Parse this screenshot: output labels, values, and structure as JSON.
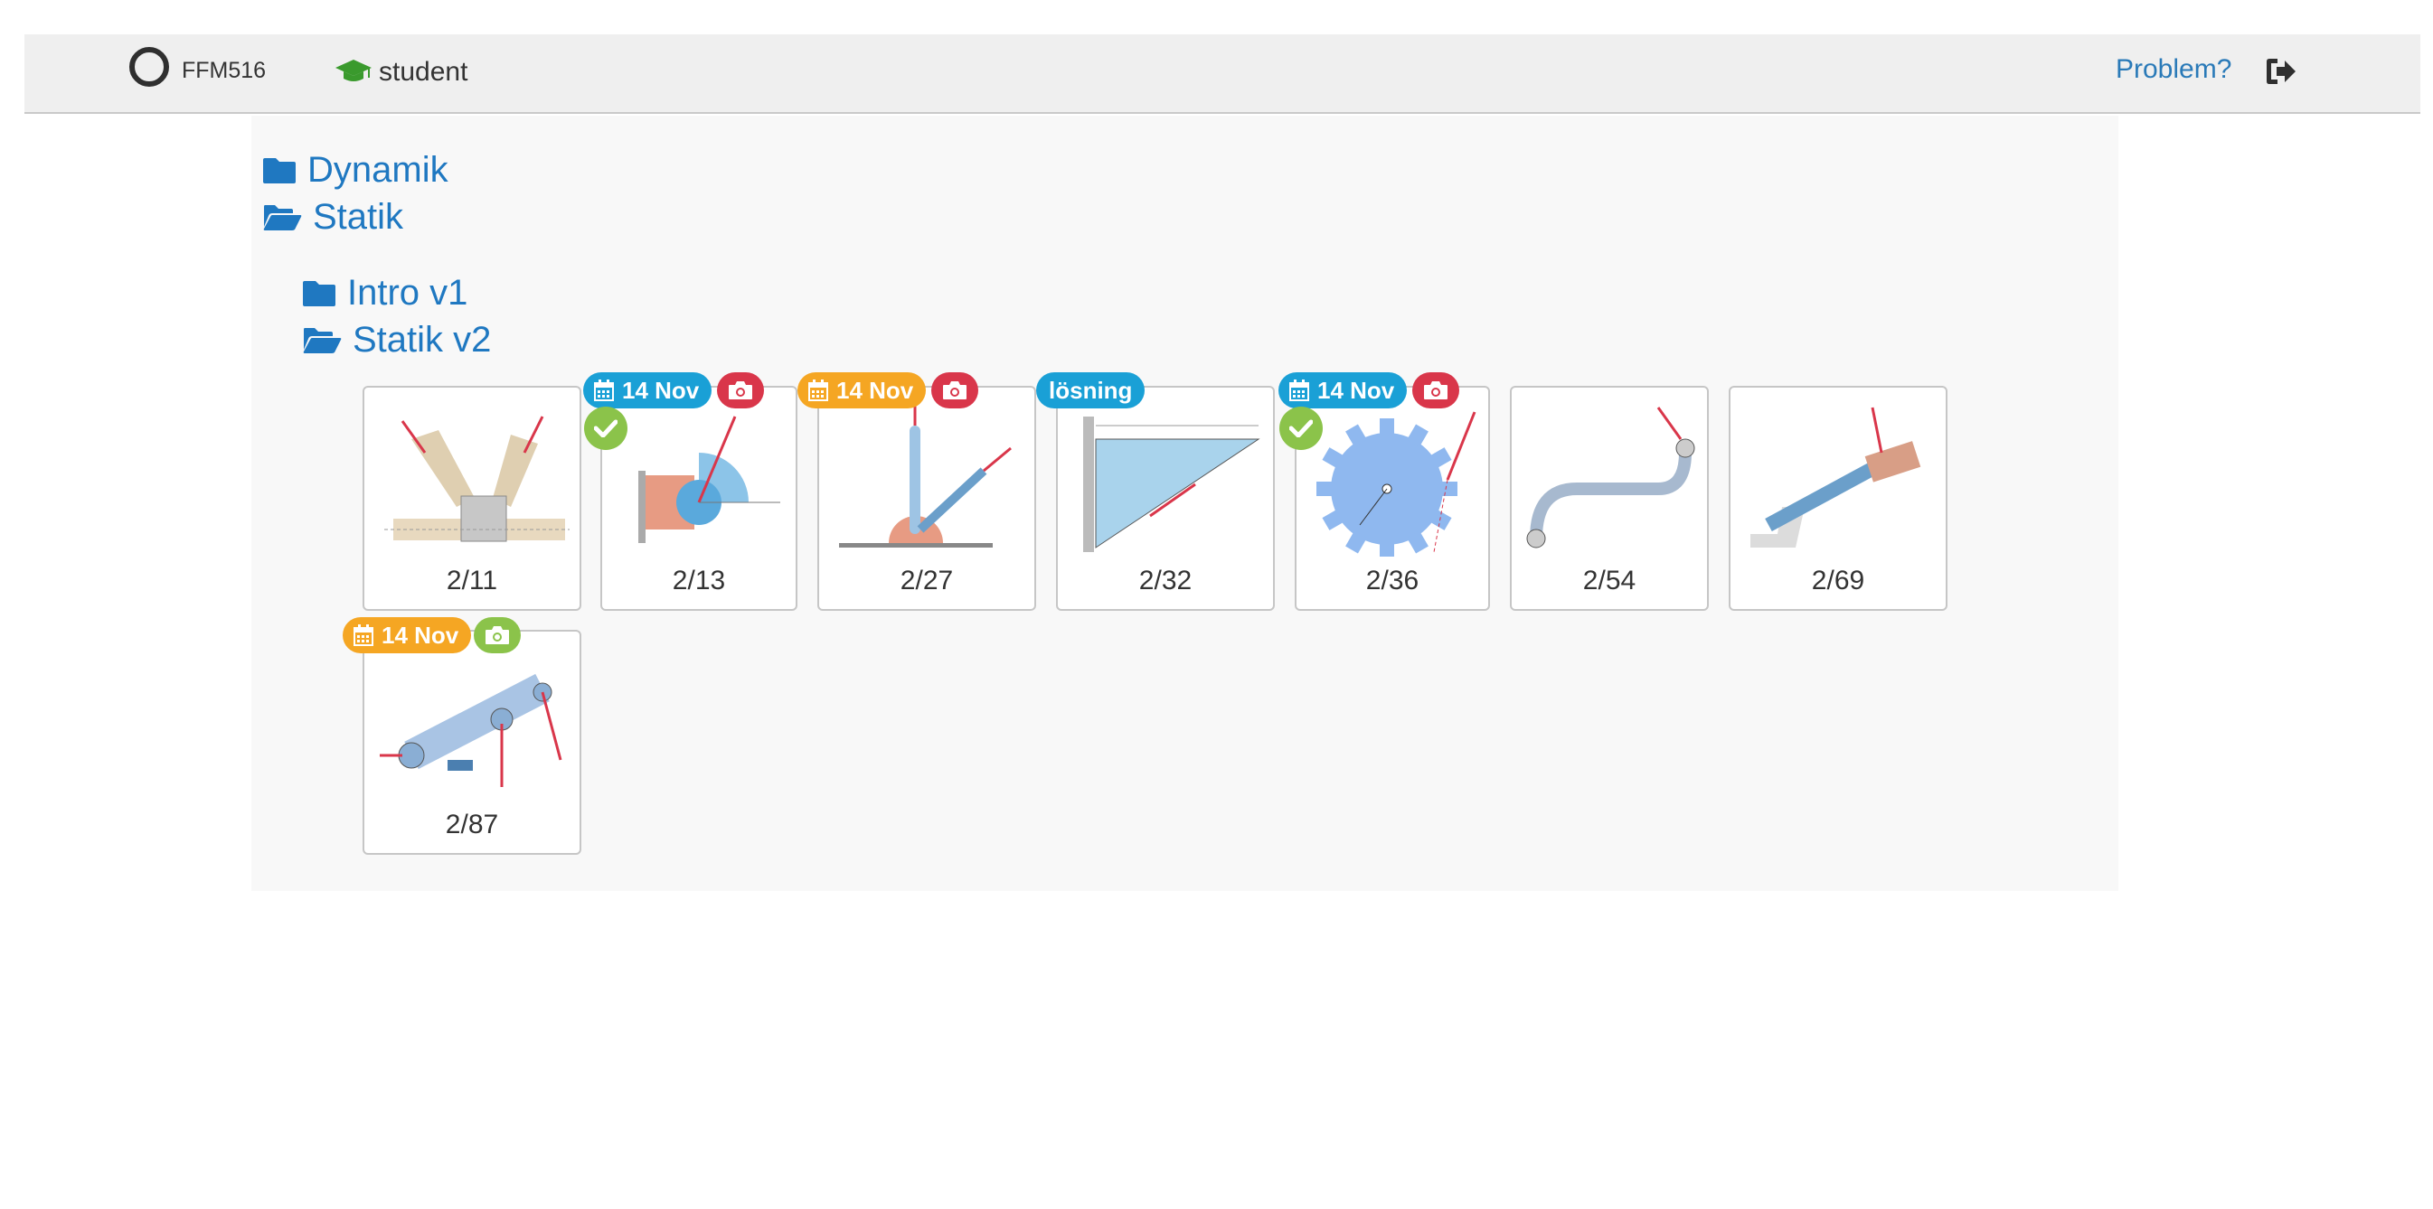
{
  "navbar": {
    "course_code": "FFM516",
    "role": "student",
    "problem_link": "Problem?",
    "icons": {
      "logo": "ring-logo-icon",
      "role": "graduation-cap-icon",
      "signout": "sign-out-icon"
    }
  },
  "folders": {
    "top": [
      {
        "label": "Dynamik",
        "state": "closed"
      },
      {
        "label": "Statik",
        "state": "open"
      }
    ],
    "sub": [
      {
        "label": "Intro v1",
        "state": "closed"
      },
      {
        "label": "Statik v2",
        "state": "open"
      }
    ]
  },
  "badges": {
    "date": "14 Nov",
    "solution": "lösning"
  },
  "problems": [
    {
      "number": "2/11",
      "date_badge": null,
      "camera": null,
      "checked": false,
      "solution": false
    },
    {
      "number": "2/13",
      "date_badge": "blue",
      "camera": "red",
      "checked": true,
      "solution": false
    },
    {
      "number": "2/27",
      "date_badge": "orange",
      "camera": "red",
      "checked": false,
      "solution": false
    },
    {
      "number": "2/32",
      "date_badge": null,
      "camera": null,
      "checked": false,
      "solution": true
    },
    {
      "number": "2/36",
      "date_badge": "blue",
      "camera": "red",
      "checked": true,
      "solution": false
    },
    {
      "number": "2/54",
      "date_badge": null,
      "camera": null,
      "checked": false,
      "solution": false
    },
    {
      "number": "2/69",
      "date_badge": null,
      "camera": null,
      "checked": false,
      "solution": false
    },
    {
      "number": "2/87",
      "date_badge": "orange",
      "camera": "green",
      "checked": false,
      "solution": false
    }
  ],
  "colors": {
    "link": "#1f78c1",
    "badge_blue": "#1aa0d6",
    "badge_orange": "#f5a623",
    "camera_red": "#d9364a",
    "check_green": "#8bc34a"
  }
}
